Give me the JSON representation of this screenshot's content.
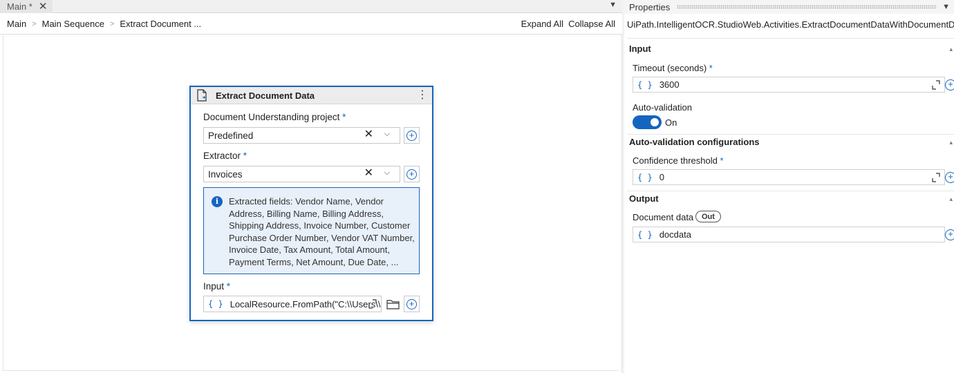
{
  "tab": {
    "label": "Main *"
  },
  "breadcrumb": [
    "Main",
    "Main Sequence",
    "Extract Document ..."
  ],
  "toolbar": {
    "expand_all": "Expand All",
    "collapse_all": "Collapse All"
  },
  "activity": {
    "title": "Extract Document Data",
    "project": {
      "label": "Document Understanding project",
      "value": "Predefined"
    },
    "extractor": {
      "label": "Extractor",
      "value": "Invoices"
    },
    "info": "Extracted fields: Vendor Name, Vendor Address, Billing Name, Billing Address, Shipping Address, Invoice Number, Customer Purchase Order Number, Vendor VAT Number, Invoice Date, Tax Amount, Total Amount, Payment Terms, Net Amount, Due Date, ...",
    "input": {
      "label": "Input",
      "value": "LocalResource.FromPath(\"C:\\\\Users\\\\"
    }
  },
  "properties": {
    "title": "Properties",
    "class_name": "UiPath.IntelligentOCR.StudioWeb.Activities.ExtractDocumentDataWithDocumentData",
    "sections": {
      "input": "Input",
      "auto_validation_configs": "Auto-validation configurations",
      "output": "Output"
    },
    "timeout": {
      "label": "Timeout (seconds)",
      "value": "3600"
    },
    "auto_validation": {
      "label": "Auto-validation",
      "state": "On"
    },
    "confidence": {
      "label": "Confidence threshold",
      "value": "0"
    },
    "document_data": {
      "label": "Document data",
      "badge": "Out",
      "value": "docdata"
    }
  },
  "colors": {
    "accent": "#1565c0"
  },
  "icons": [
    "close-icon",
    "chevron-down-icon",
    "chevron-right-icon",
    "document-icon",
    "more-vert-icon",
    "clear-icon",
    "plus-circle-icon",
    "info-icon",
    "expand-icon",
    "folder-icon",
    "braces-icon"
  ]
}
